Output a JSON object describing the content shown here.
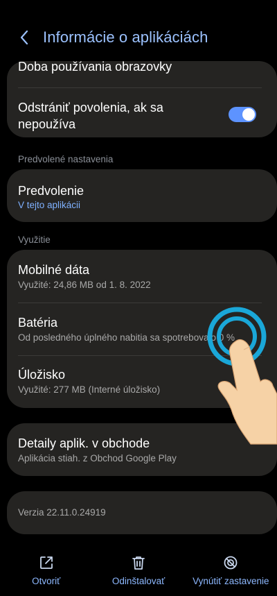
{
  "header": {
    "title": "Informácie o aplikáciách"
  },
  "top_card": {
    "screen_time": "Doba používania obrazovky",
    "remove_permissions_line1": "Odstrániť povolenia, ak sa",
    "remove_permissions_line2": "nepoužíva",
    "remove_permissions_on": true
  },
  "defaults_section": {
    "header": "Predvolené nastavenia",
    "title": "Predvolenie",
    "subtitle": "V tejto aplikácii"
  },
  "usage_section": {
    "header": "Využitie",
    "items": [
      {
        "title": "Mobilné dáta",
        "subtitle": "Využité: 24,86 MB od 1. 8. 2022"
      },
      {
        "title": "Batéria",
        "subtitle": "Od posledného úplného nabitia sa spotrebovalo 0 %"
      },
      {
        "title": "Úložisko",
        "subtitle": "Využité: 277 MB (Interné úložisko)"
      }
    ]
  },
  "store_card": {
    "title": "Detaily aplik. v obchode",
    "subtitle": "Aplikácia stiah. z Obchod Google Play"
  },
  "version": "Verzia 22.11.0.24919",
  "bottom_bar": {
    "open": "Otvoriť",
    "uninstall": "Odinštalovať",
    "force_stop": "Vynútiť zastavenie"
  },
  "colors": {
    "accent": "#9cc2ff",
    "toggle": "#5d93ff",
    "card": "#252422",
    "tap_ring": "#1aa7d8"
  },
  "icons": [
    "chevron-left-icon",
    "open-external-icon",
    "trash-icon",
    "stop-circle-icon",
    "tap-hand-icon"
  ]
}
